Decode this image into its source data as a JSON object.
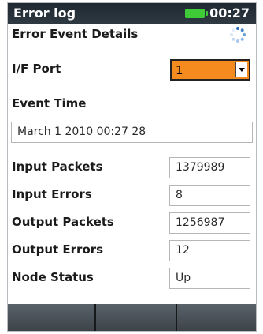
{
  "titlebar": {
    "title": "Error log",
    "time": "00:27",
    "battery_icon": "battery-icon",
    "battery_color": "#3fcb37"
  },
  "page": {
    "heading": "Error Event Details",
    "loading_icon": "loading-spinner-icon"
  },
  "port": {
    "label": "I/F Port",
    "value": "1",
    "accent": "#f58a1f"
  },
  "event_time": {
    "label": "Event Time",
    "value": "March 1 2010 00:27 28"
  },
  "stats": [
    {
      "label": "Input Packets",
      "value": "1379989"
    },
    {
      "label": "Input Errors",
      "value": "8"
    },
    {
      "label": "Output Packets",
      "value": "1256987"
    },
    {
      "label": "Output Errors",
      "value": "12"
    },
    {
      "label": "Node Status",
      "value": "Up"
    }
  ],
  "softkeys": [
    "",
    "",
    ""
  ]
}
